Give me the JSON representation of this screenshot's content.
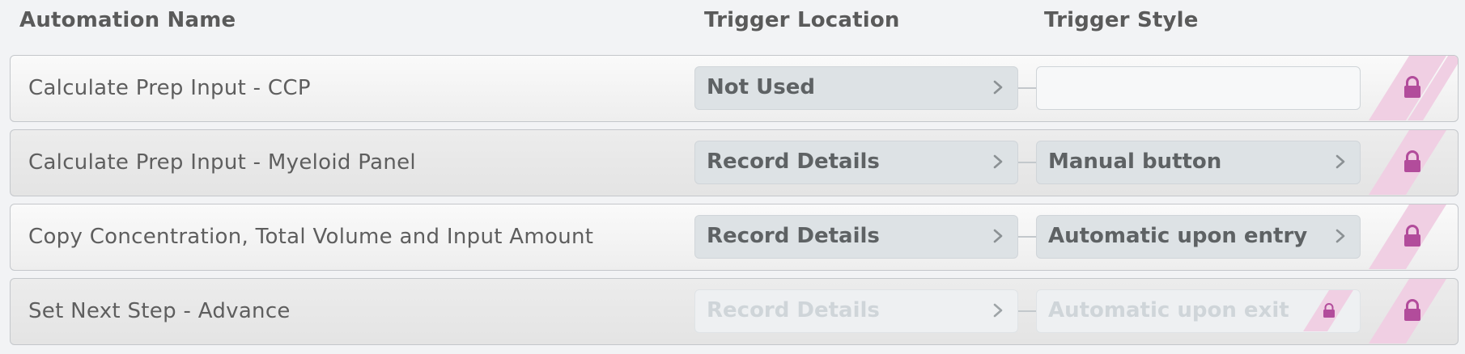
{
  "columns": {
    "name": "Automation Name",
    "location": "Trigger Location",
    "style": "Trigger Style"
  },
  "rows": [
    {
      "name": "Calculate Prep Input - CCP",
      "trigger_location": "Not Used",
      "trigger_style": "",
      "locked": true,
      "disabled": false
    },
    {
      "name": "Calculate Prep Input - Myeloid Panel",
      "trigger_location": "Record Details",
      "trigger_style": "Manual button",
      "locked": true,
      "disabled": false
    },
    {
      "name": "Copy Concentration, Total Volume and Input Amount",
      "trigger_location": "Record Details",
      "trigger_style": "Automatic upon entry",
      "locked": true,
      "disabled": false
    },
    {
      "name": "Set Next Step - Advance",
      "trigger_location": "Record Details",
      "trigger_style": "Automatic upon exit",
      "locked": true,
      "disabled": true
    }
  ],
  "icons": {
    "lock": "lock-icon",
    "chevron": "chevron-right-icon"
  },
  "colors": {
    "lock": "#b24c9b",
    "lock_stripe": "#f0cfe3"
  }
}
